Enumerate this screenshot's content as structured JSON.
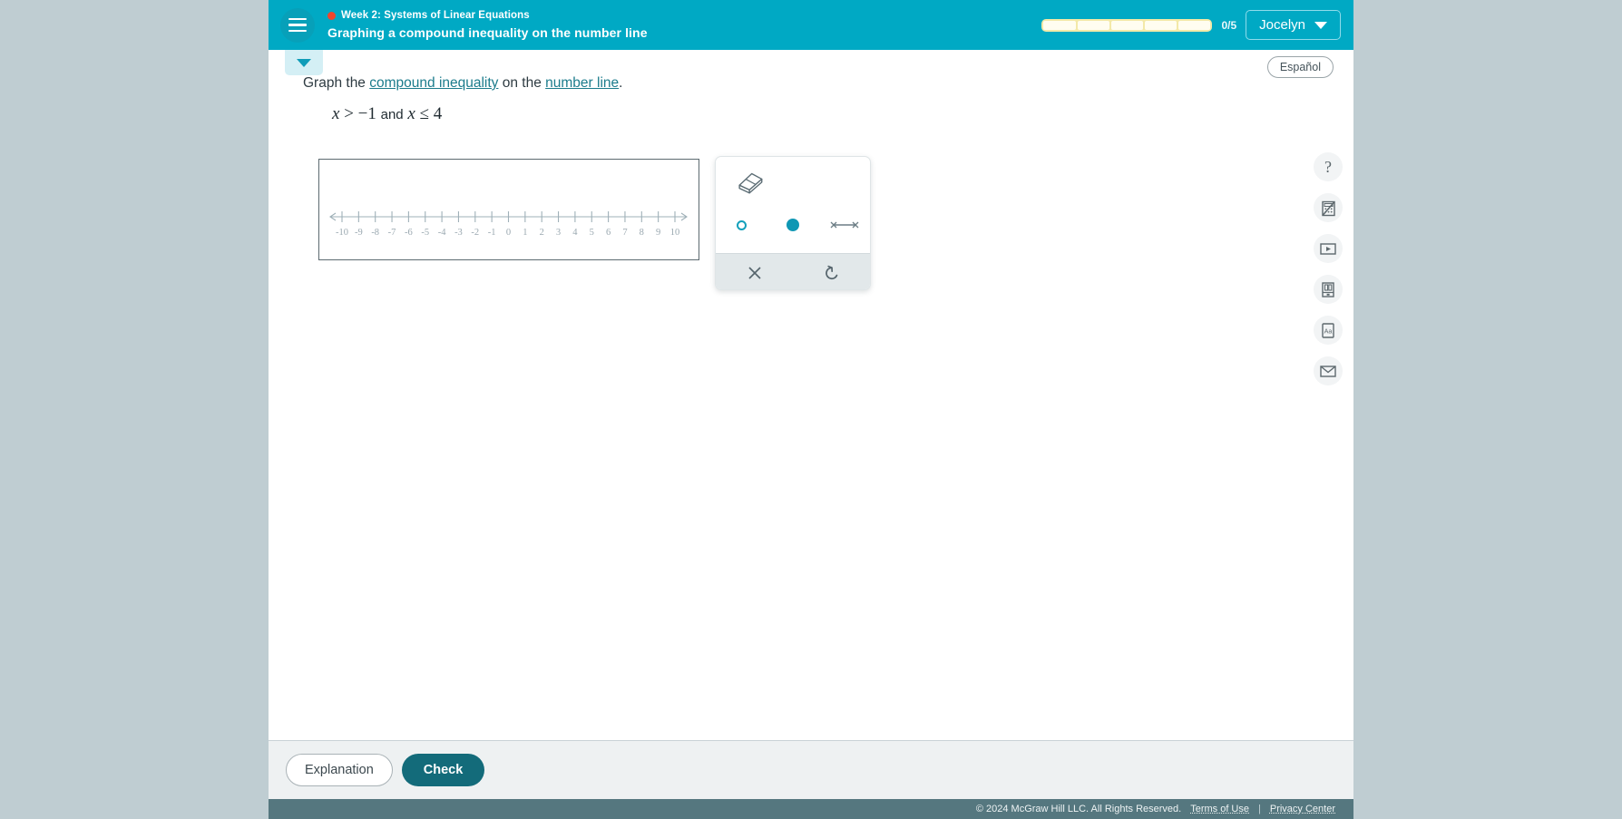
{
  "header": {
    "menu_icon": "hamburger-icon",
    "notification_dot": "record-dot-icon",
    "kicker": "Week 2: Systems of Linear Equations",
    "title": "Graphing a compound inequality on the number line",
    "progress_label": "0/5",
    "progress_total": 5,
    "progress_done": 0,
    "user_name": "Jocelyn",
    "user_chevron_icon": "chevron-down-icon"
  },
  "toolbar": {
    "collapse_icon": "chevron-down-icon",
    "espanol_label": "Español"
  },
  "prompt": {
    "lead": "Graph the ",
    "link1": "compound inequality",
    "mid": " on the ",
    "link2": "number line",
    "end": ".",
    "equation": {
      "var1": "x",
      "op1": ">",
      "value1": "−1",
      "conjunction": "and",
      "var2": "x",
      "op2": "≤",
      "value2": "4"
    }
  },
  "number_line": {
    "min": -10,
    "max": 10,
    "ticks": [
      "-10",
      "-9",
      "-8",
      "-7",
      "-6",
      "-5",
      "-4",
      "-3",
      "-2",
      "-1",
      "0",
      "1",
      "2",
      "3",
      "4",
      "5",
      "6",
      "7",
      "8",
      "9",
      "10"
    ],
    "left_arrow_icon": "arrow-left-icon",
    "right_arrow_icon": "arrow-right-icon",
    "plotted_points": []
  },
  "palette": {
    "eraser_icon": "eraser-icon",
    "tools": [
      {
        "name": "open-circle-tool",
        "icon": "open-circle-icon",
        "selected": false
      },
      {
        "name": "closed-circle-tool",
        "icon": "filled-circle-icon",
        "selected": false
      },
      {
        "name": "segment-tool",
        "icon": "line-segment-icon",
        "selected": false
      }
    ],
    "delete_icon": "close-x-icon",
    "undo_icon": "undo-arrow-icon"
  },
  "rail": {
    "items": [
      {
        "name": "help-button",
        "icon": "question-mark-icon",
        "glyph": "?"
      },
      {
        "name": "calculator-button",
        "icon": "calculator-disabled-icon",
        "glyph": ""
      },
      {
        "name": "video-button",
        "icon": "video-play-icon",
        "glyph": ""
      },
      {
        "name": "reference-button",
        "icon": "reference-book-icon",
        "glyph": ""
      },
      {
        "name": "glossary-button",
        "icon": "glossary-aa-icon",
        "glyph": ""
      },
      {
        "name": "message-button",
        "icon": "envelope-icon",
        "glyph": ""
      }
    ]
  },
  "actions": {
    "explanation_label": "Explanation",
    "check_label": "Check"
  },
  "footer": {
    "copyright": "© 2024 McGraw Hill LLC. All Rights Reserved.",
    "terms_label": "Terms of Use",
    "separator": "|",
    "privacy_label": "Privacy Center"
  },
  "colors": {
    "header_teal": "#00a9c4",
    "accent_teal": "#0f97b4",
    "check_button": "#136b7a",
    "page_background": "#bfcdd2",
    "footer_bar": "#55777f",
    "progress_fill": "#f3e9a8"
  }
}
